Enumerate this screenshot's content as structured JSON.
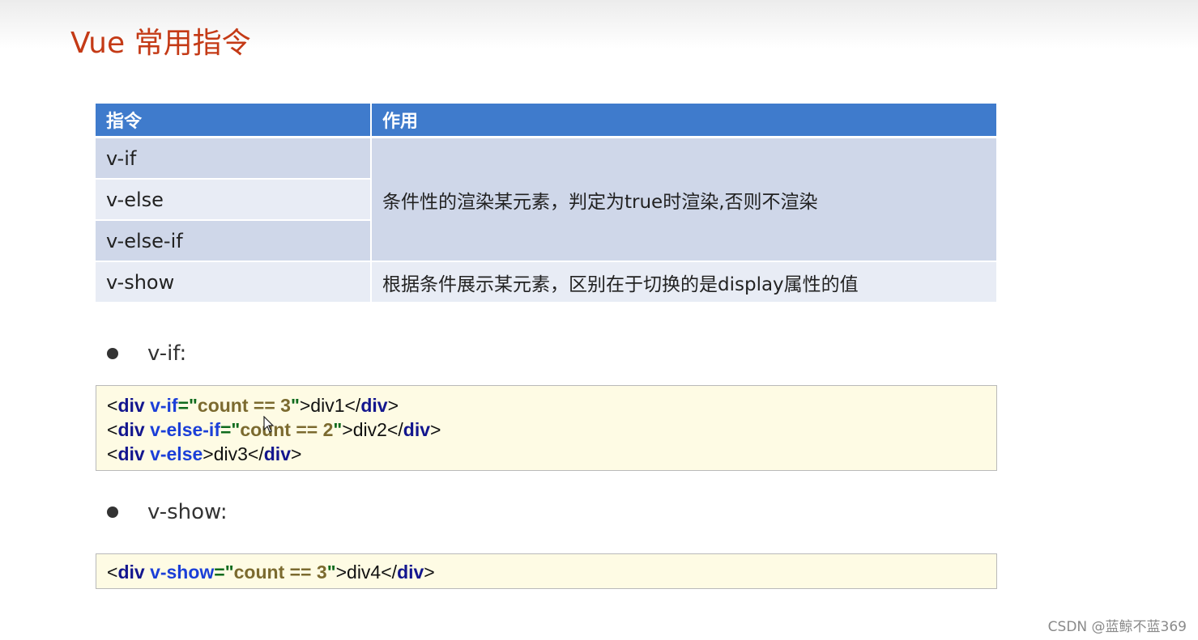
{
  "title": "Vue 常用指令",
  "table": {
    "headers": [
      "指令",
      "作用"
    ],
    "rows": [
      {
        "directive": "v-if"
      },
      {
        "directive": "v-else"
      },
      {
        "directive": "v-else-if"
      },
      {
        "directive": "v-show",
        "desc": "根据条件展示某元素，区别在于切换的是display属性的值"
      }
    ],
    "group_desc": "条件性的渲染某元素，判定为true时渲染,否则不渲染"
  },
  "bullets": [
    "v-if:",
    "v-show:"
  ],
  "code_vif": [
    {
      "open": "<",
      "tag": "div",
      "sp": " ",
      "attr": "v-if",
      "eq": "=\"",
      "val": "count == 3",
      "q": "\"",
      "gt": ">",
      "text": "div1",
      "close_open": "</",
      "close_tag": "div",
      "close_gt": ">"
    },
    {
      "open": "<",
      "tag": "div",
      "sp": " ",
      "attr": "v-else-if",
      "eq": "=\"",
      "val": "count == 2",
      "q": "\"",
      "gt": ">",
      "text": "div2",
      "close_open": "</",
      "close_tag": "div",
      "close_gt": ">"
    },
    {
      "open": "<",
      "tag": "div",
      "sp": " ",
      "attr": "v-else",
      "gt": ">",
      "text": "div3",
      "close_open": "</",
      "close_tag": "div",
      "close_gt": ">"
    }
  ],
  "code_vshow": {
    "open": "<",
    "tag": "div",
    "sp": " ",
    "attr": "v-show",
    "eq": "=\"",
    "val": "count == 3",
    "q": "\"",
    "gt": ">",
    "text": "div4",
    "close_open": "</",
    "close_tag": "div",
    "close_gt": ">"
  },
  "watermark": "CSDN @蓝鲸不蓝369"
}
